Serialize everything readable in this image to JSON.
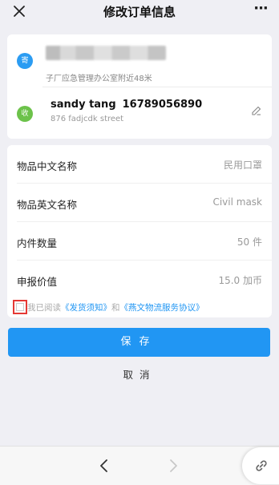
{
  "header": {
    "title": "修改订单信息",
    "more_label": "···"
  },
  "sender": {
    "badge": "寄",
    "address": "子厂应急管理办公室附近48米"
  },
  "receiver": {
    "badge": "收",
    "name": "sandy tang",
    "phone": "16789056890",
    "address": "876 fadjcdk street"
  },
  "form": {
    "rows": [
      {
        "label": "物品中文名称",
        "value": "民用口罩"
      },
      {
        "label": "物品英文名称",
        "value": "Civil mask"
      },
      {
        "label": "内件数量",
        "value": "50 件"
      },
      {
        "label": "申报价值",
        "value": "15.0 加币"
      }
    ]
  },
  "agreement": {
    "prefix": "我已阅读",
    "link1": "《发货须知》",
    "joiner": "和",
    "link2": "《燕文物流服务协议》"
  },
  "actions": {
    "save_label": "保存",
    "cancel_label": "取消"
  },
  "colors": {
    "accent": "#2196f3",
    "sender_badge": "#2b9cf2",
    "receiver_badge": "#6cc24a",
    "highlight_border": "#e53935"
  }
}
